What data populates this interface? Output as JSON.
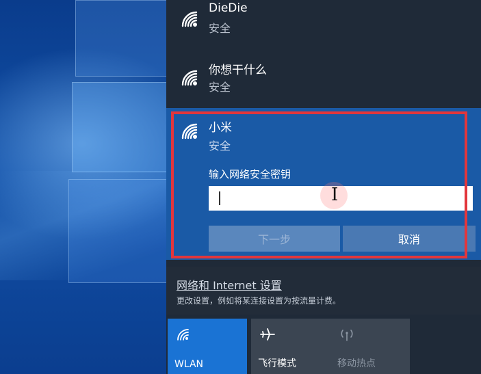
{
  "networks": [
    {
      "name": "DieDie",
      "status": "安全"
    },
    {
      "name": "你想干什么",
      "status": "安全"
    }
  ],
  "active_network": {
    "name": "小米",
    "status": "安全",
    "key_label": "输入网络安全密钥",
    "key_value": "",
    "next_label": "下一步",
    "cancel_label": "取消"
  },
  "settings": {
    "link": "网络和 Internet 设置",
    "desc": "更改设置，例如将某连接设置为按流量计费。"
  },
  "quick_actions": [
    {
      "label": "WLAN",
      "icon": "wifi-icon",
      "state": "on"
    },
    {
      "label": "飞行模式",
      "icon": "airplane-icon",
      "state": "off"
    },
    {
      "label": "移动热点",
      "icon": "hotspot-icon",
      "state": "disabled"
    }
  ],
  "colors": {
    "accent": "#1a73d4",
    "selected_bg": "#1a5aa6",
    "highlight": "#e2363c",
    "panel_bg": "#1f2a38"
  }
}
